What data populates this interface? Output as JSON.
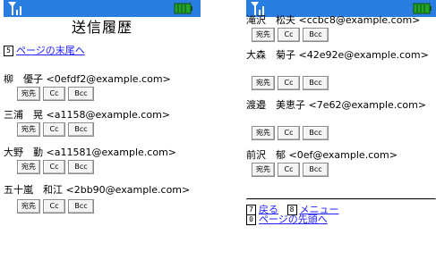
{
  "left_screen": {
    "title": "送信履歴",
    "nav_top": {
      "key": "5",
      "label": "ページの末尾へ"
    },
    "entries": [
      {
        "contact": "柳　優子 <0efdf2@example.com>",
        "buttons": [
          "宛先",
          "Cc",
          "Bcc"
        ]
      },
      {
        "contact": "三浦　晃 <a1158@example.com>",
        "buttons": [
          "宛先",
          "Cc",
          "Bcc"
        ]
      },
      {
        "contact": "大野　勤 <a11581@example.com>",
        "buttons": [
          "宛先",
          "Cc",
          "Bcc"
        ]
      },
      {
        "contact": "五十嵐　和江 <2bb90@example.com>",
        "buttons": [
          "宛先",
          "Cc",
          "Bcc"
        ]
      }
    ]
  },
  "right_screen": {
    "entries": [
      {
        "contact": "滝沢　松夫 <ccbc8@example.com>",
        "buttons": [
          "宛先",
          "Cc",
          "Bcc"
        ]
      },
      {
        "contact": "大森　菊子 <42e92e@example.com>",
        "buttons": [
          "宛先",
          "Cc",
          "Bcc"
        ]
      },
      {
        "contact": "渡邉　美恵子 <7e62@example.com>",
        "buttons": [
          "宛先",
          "Cc",
          "Bcc"
        ]
      },
      {
        "contact": "前沢　郁 <0ef@example.com>",
        "buttons": [
          "宛先",
          "Cc",
          "Bcc"
        ]
      }
    ],
    "nav_bottom": {
      "back": {
        "key": "7",
        "label": "戻る"
      },
      "menu": {
        "key": "8",
        "label": "メニュー"
      },
      "top": {
        "key": "0",
        "label": "ページの先頭へ"
      }
    }
  },
  "colors": {
    "statusbar": "#2a7de0",
    "battery": "#23a32a",
    "link": "#2020ff"
  }
}
